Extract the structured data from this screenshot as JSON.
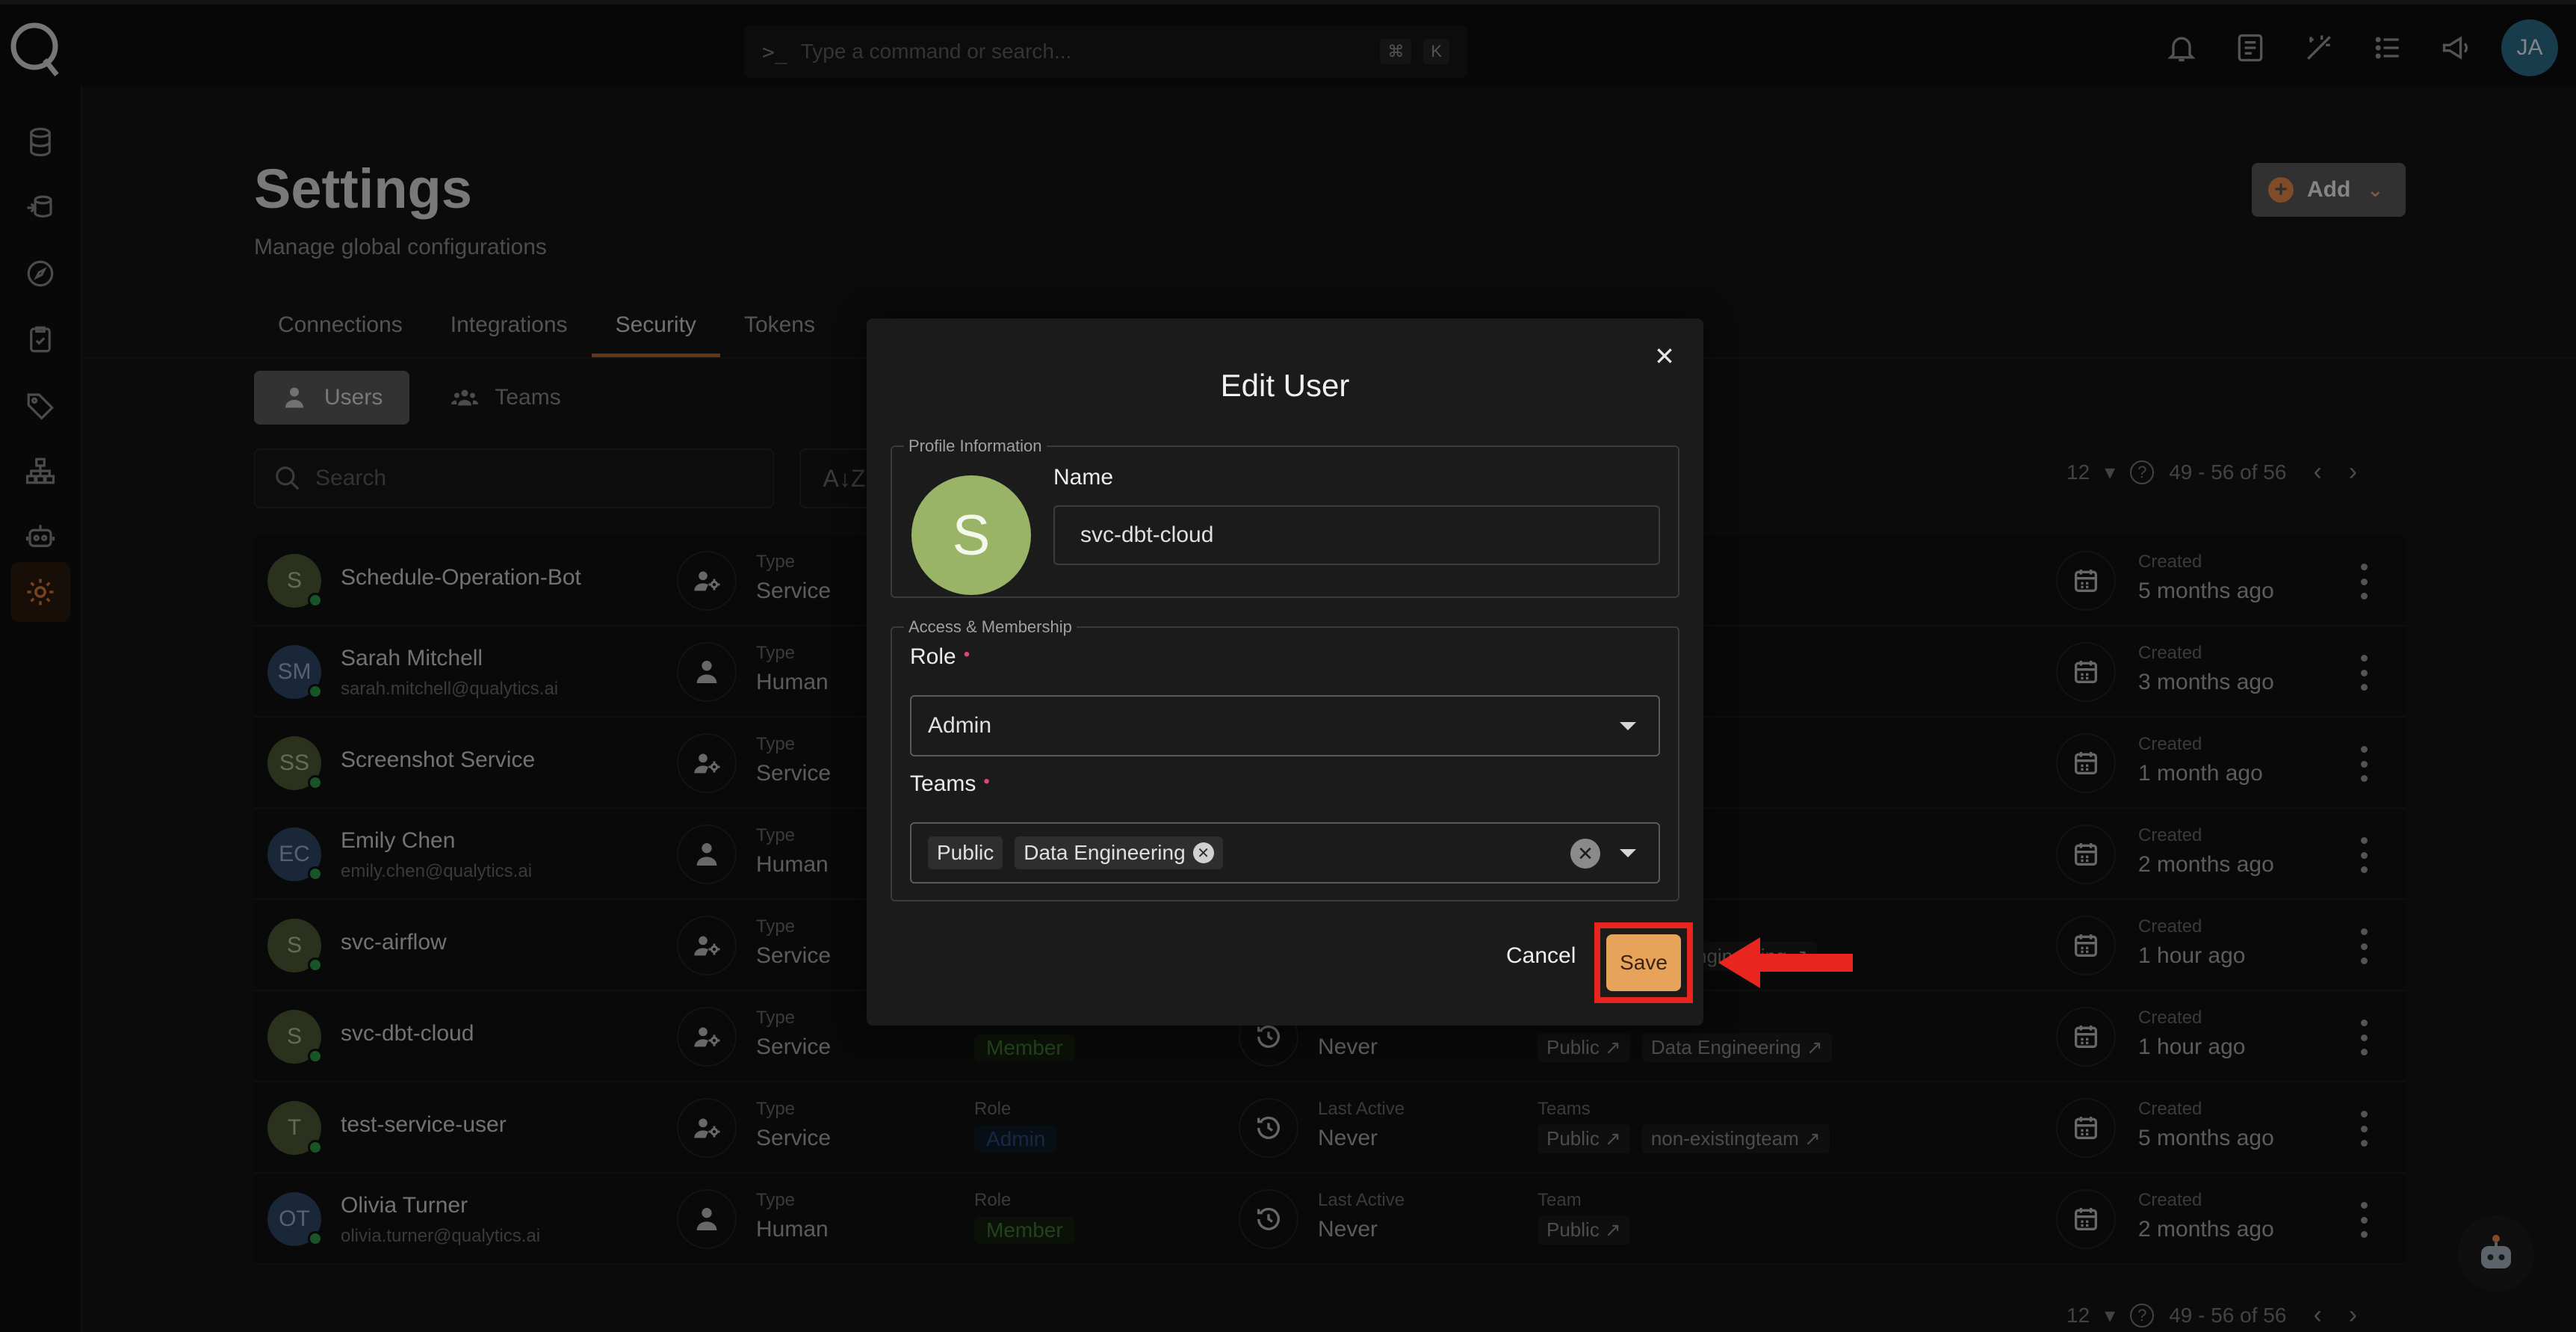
{
  "header": {
    "command_placeholder": "Type a command or search...",
    "shortcut_keys": [
      "⌘",
      "K"
    ],
    "user_initials": "JA",
    "icons": [
      "bell-icon",
      "document-icon",
      "magic-wand-icon",
      "list-icon",
      "megaphone-icon"
    ]
  },
  "sidebar": {
    "icons": [
      "database-icon",
      "data-stack-icon",
      "compass-icon",
      "checklist-icon",
      "tag-icon",
      "hierarchy-icon",
      "robot-icon",
      "gear-icon"
    ],
    "active": "gear-icon"
  },
  "page": {
    "title": "Settings",
    "subtitle": "Manage global configurations",
    "add_label": "Add"
  },
  "tabs": [
    {
      "label": "Connections"
    },
    {
      "label": "Integrations"
    },
    {
      "label": "Security",
      "active": true
    },
    {
      "label": "Tokens"
    }
  ],
  "subtabs": [
    {
      "label": "Users",
      "active": true
    },
    {
      "label": "Teams"
    }
  ],
  "search": {
    "placeholder": "Search"
  },
  "pagination": {
    "per_page": "12",
    "range": "49 - 56 of 56"
  },
  "users": [
    {
      "initials": "S",
      "name": "Schedule-Operation-Bot",
      "email": "",
      "type_label": "Type",
      "type": "Service",
      "created_label": "Created",
      "created": "5 months ago",
      "avatar": "green"
    },
    {
      "initials": "SM",
      "name": "Sarah Mitchell",
      "email": "sarah.mitchell@qualytics.ai",
      "type_label": "Type",
      "type": "Human",
      "created_label": "Created",
      "created": "3 months ago",
      "avatar": "blue"
    },
    {
      "initials": "SS",
      "name": "Screenshot Service",
      "email": "",
      "type_label": "Type",
      "type": "Service",
      "created_label": "Created",
      "created": "1 month ago",
      "avatar": "green"
    },
    {
      "initials": "EC",
      "name": "Emily Chen",
      "email": "emily.chen@qualytics.ai",
      "type_label": "Type",
      "type": "Human",
      "created_label": "Created",
      "created": "2 months ago",
      "avatar": "blue"
    },
    {
      "initials": "S",
      "name": "svc-airflow",
      "email": "",
      "type_label": "Type",
      "type": "Service",
      "created_label": "Created",
      "created": "1 hour ago",
      "avatar": "green",
      "teams_partial": "ngineering"
    },
    {
      "initials": "S",
      "name": "svc-dbt-cloud",
      "email": "",
      "type_label": "Type",
      "type": "Service",
      "role": "Member",
      "role_class": "member",
      "active_value": "Never",
      "teams": [
        "Public",
        "Data Engineering"
      ],
      "created_label": "Created",
      "created": "1 hour ago",
      "avatar": "green"
    },
    {
      "initials": "T",
      "name": "test-service-user",
      "email": "",
      "type_label": "Type",
      "type": "Service",
      "role_label": "Role",
      "role": "Admin",
      "role_class": "admin",
      "active_label": "Last Active",
      "active_value": "Never",
      "teams_label": "Teams",
      "teams": [
        "Public",
        "non-existingteam"
      ],
      "created_label": "Created",
      "created": "5 months ago",
      "avatar": "green"
    },
    {
      "initials": "OT",
      "name": "Olivia Turner",
      "email": "olivia.turner@qualytics.ai",
      "type_label": "Type",
      "type": "Human",
      "role_label": "Role",
      "role": "Member",
      "role_class": "member",
      "active_label": "Last Active",
      "active_value": "Never",
      "teams_label": "Team",
      "teams": [
        "Public"
      ],
      "created_label": "Created",
      "created": "2 months ago",
      "avatar": "blue"
    }
  ],
  "modal": {
    "title": "Edit User",
    "profile_legend": "Profile Information",
    "avatar_initial": "S",
    "name_label": "Name",
    "name_value": "svc-dbt-cloud",
    "access_legend": "Access & Membership",
    "role_label": "Role",
    "role_value": "Admin",
    "teams_label": "Teams",
    "teams": [
      "Public",
      "Data Engineering"
    ],
    "cancel_label": "Cancel",
    "save_label": "Save",
    "required_marker": "•"
  },
  "colors": {
    "accent": "#e8a35b",
    "highlight": "#e8251f",
    "required": "#e0457a"
  }
}
